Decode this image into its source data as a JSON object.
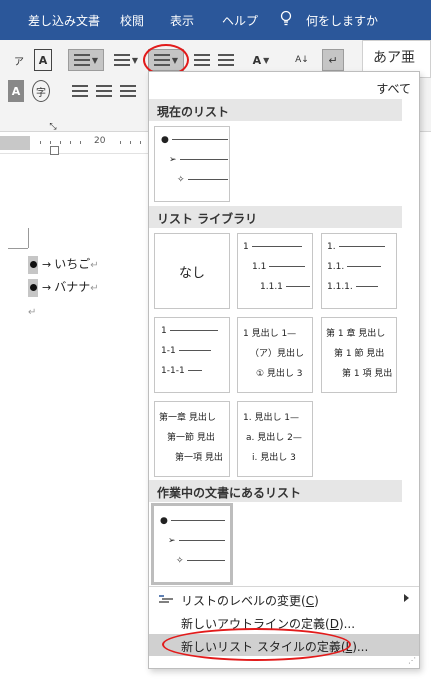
{
  "tabs": [
    "差し込み文書",
    "校閲",
    "表示",
    "ヘルプ"
  ],
  "tell_me": "何をしますか",
  "style_preview": "あア亜",
  "ruler_number": "20",
  "document": {
    "items": [
      "いちご",
      "バナナ"
    ],
    "return_mark": "↵",
    "arrow": "→"
  },
  "menu": {
    "all_label": "すべて",
    "sections": {
      "current": "現在のリスト",
      "library": "リスト ライブラリ",
      "in_doc": "作業中の文書にあるリスト"
    },
    "none_label": "なし",
    "lib_numeric_a": [
      "1",
      "1.1",
      "1.1.1"
    ],
    "lib_numeric_b": [
      "1.",
      "1.1.",
      "1.1.1."
    ],
    "lib_numeric_c": [
      "1",
      "1-1",
      "1-1-1"
    ],
    "lib_heading_a": [
      "1 見出し 1—",
      "（ア）見出し",
      "① 見出し 3"
    ],
    "lib_chapter_a": [
      "第 1 章 見出し",
      "第 1 節 見出",
      "第 1 項 見出"
    ],
    "lib_chapter_b": [
      "第一章 見出し",
      "第一節 見出",
      "第一項 見出"
    ],
    "lib_heading_b": [
      "1. 見出し 1—",
      "a. 見出し 2—",
      "i. 見出し 3"
    ],
    "items": {
      "change_level": "リストのレベルの変更(",
      "change_level_key": "C",
      "change_level_end": ")",
      "define_outline": "新しいアウトラインの定義(",
      "define_outline_key": "D",
      "define_outline_end": ")...",
      "define_style": "新しいリスト スタイルの定義(",
      "define_style_key": "L",
      "define_style_end": ")..."
    }
  },
  "colors": {
    "ribbon_tab_bg": "#2b579a",
    "highlight_circle": "#e21b1b"
  }
}
